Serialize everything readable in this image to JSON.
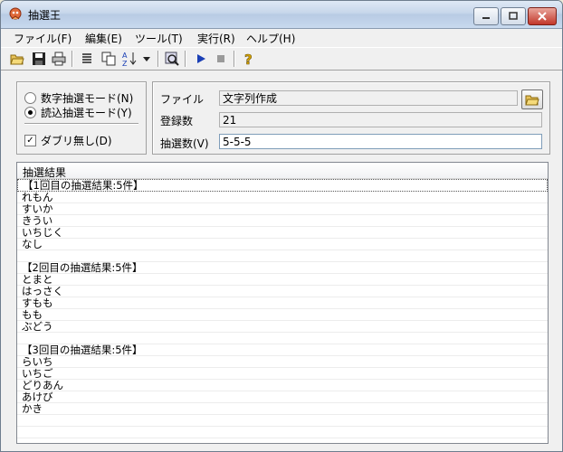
{
  "window": {
    "title": "抽選王"
  },
  "menu": {
    "file": "ファイル(F)",
    "edit": "編集(E)",
    "tools": "ツール(T)",
    "run": "実行(R)",
    "help": "ヘルプ(H)"
  },
  "toolbar": {
    "icons": [
      "open-folder-icon",
      "save-icon",
      "print-icon",
      "list-icon",
      "copy-icon",
      "sort-az-icon",
      "dropdown-arrow-icon",
      "settings-icon",
      "play-icon",
      "stop-icon",
      "help-icon"
    ]
  },
  "mode": {
    "numeric_label": "数字抽選モード(N)",
    "load_label": "読込抽選モード(Y)",
    "selected": "load",
    "no_duplicates_label": "ダブリ無し(D)",
    "no_duplicates_checked": true
  },
  "settings": {
    "file_label": "ファイル",
    "file_value": "文字列作成",
    "count_label": "登録数",
    "count_value": "21",
    "draw_label": "抽選数(V)",
    "draw_value": "5-5-5"
  },
  "results": {
    "header": "抽選結果",
    "lines": [
      "【1回目の抽選結果:5件】",
      "れもん",
      "すいか",
      "きうい",
      "いちじく",
      "なし",
      "",
      "【2回目の抽選結果:5件】",
      "とまと",
      "はっさく",
      "すもも",
      "もも",
      "ぶどう",
      "",
      "【3回目の抽選結果:5件】",
      "らいち",
      "いちご",
      "どりあん",
      "あけび",
      "かき",
      "",
      "",
      ""
    ]
  },
  "colors": {
    "accent_play": "#1a3fb5",
    "help_icon": "#d9a600"
  }
}
